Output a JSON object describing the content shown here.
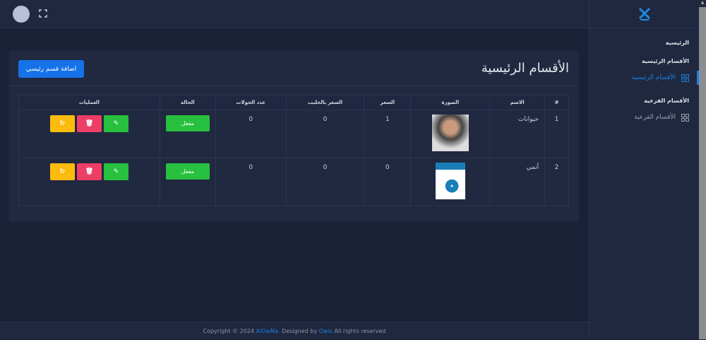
{
  "page": {
    "title": "الأقسام الرئيسية",
    "add_button": "اضافة قسم رئيسي"
  },
  "sidebar": {
    "home": "الرئيسية",
    "main_header": "الأقسام الرئيسية",
    "main_item": "الأقسام الرئيسية",
    "sub_header": "الأقسام الفرعية",
    "sub_item": "الأقسام الفرعية"
  },
  "table": {
    "headers": [
      "#",
      "الاسم",
      "الصورة",
      "السعر",
      "السعر بالحليب",
      "عدد الجولات",
      "الحالة",
      "العمليات"
    ],
    "rows": [
      {
        "id": "1",
        "name": "حيوانات",
        "price": "1",
        "milk_price": "0",
        "rounds": "0",
        "status": "مفعل"
      },
      {
        "id": "2",
        "name": "أنمي",
        "price": "0",
        "milk_price": "0",
        "rounds": "0",
        "status": "مفعل"
      }
    ]
  },
  "footer": {
    "pre": "Copyright © 2024 ",
    "brand": "AlOwNa.",
    "mid": " Designed by ",
    "designer": "Owis",
    "post": " All rights reserved"
  },
  "colors": {
    "accent": "#1572e8",
    "success": "#28c03f",
    "danger": "#ed3e65",
    "warning": "#fdbb0e"
  }
}
